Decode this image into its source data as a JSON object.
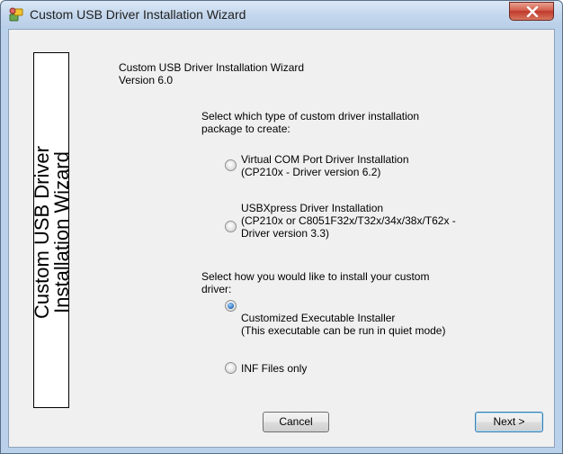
{
  "window": {
    "title": "Custom USB Driver Installation Wizard"
  },
  "side_panel": {
    "line1": "Custom USB Driver",
    "line2": "Installation Wizard"
  },
  "header": {
    "app_name": "Custom USB Driver Installation Wizard",
    "version": "Version 6.0"
  },
  "package_section": {
    "prompt_line1": "Select which type of custom driver installation",
    "prompt_line2": "package to create:",
    "options": [
      {
        "lines": [
          "Virtual COM Port Driver Installation",
          "(CP210x - Driver version 6.2)"
        ],
        "checked": false
      },
      {
        "lines": [
          "USBXpress Driver Installation",
          "(CP210x or C8051F32x/T32x/34x/38x/T62x -",
          "Driver version 3.3)"
        ],
        "checked": false
      }
    ]
  },
  "install_section": {
    "prompt_line1": "Select how you would like to install your custom",
    "prompt_line2": "driver:",
    "options": [
      {
        "lines": [
          "Customized Executable Installer",
          "(This executable can be run in quiet mode)"
        ],
        "checked": true
      },
      {
        "lines": [
          "INF Files only"
        ],
        "checked": false
      }
    ]
  },
  "buttons": {
    "cancel": "Cancel",
    "next": "Next >"
  },
  "colors": {
    "title_bar": "#c3d6ec",
    "close_button": "#c0392b",
    "dialog_background": "#f0f0f0",
    "radio_selected": "#1f66b5"
  },
  "icons": {
    "app": "usb-wizard-icon",
    "close": "close-icon"
  }
}
